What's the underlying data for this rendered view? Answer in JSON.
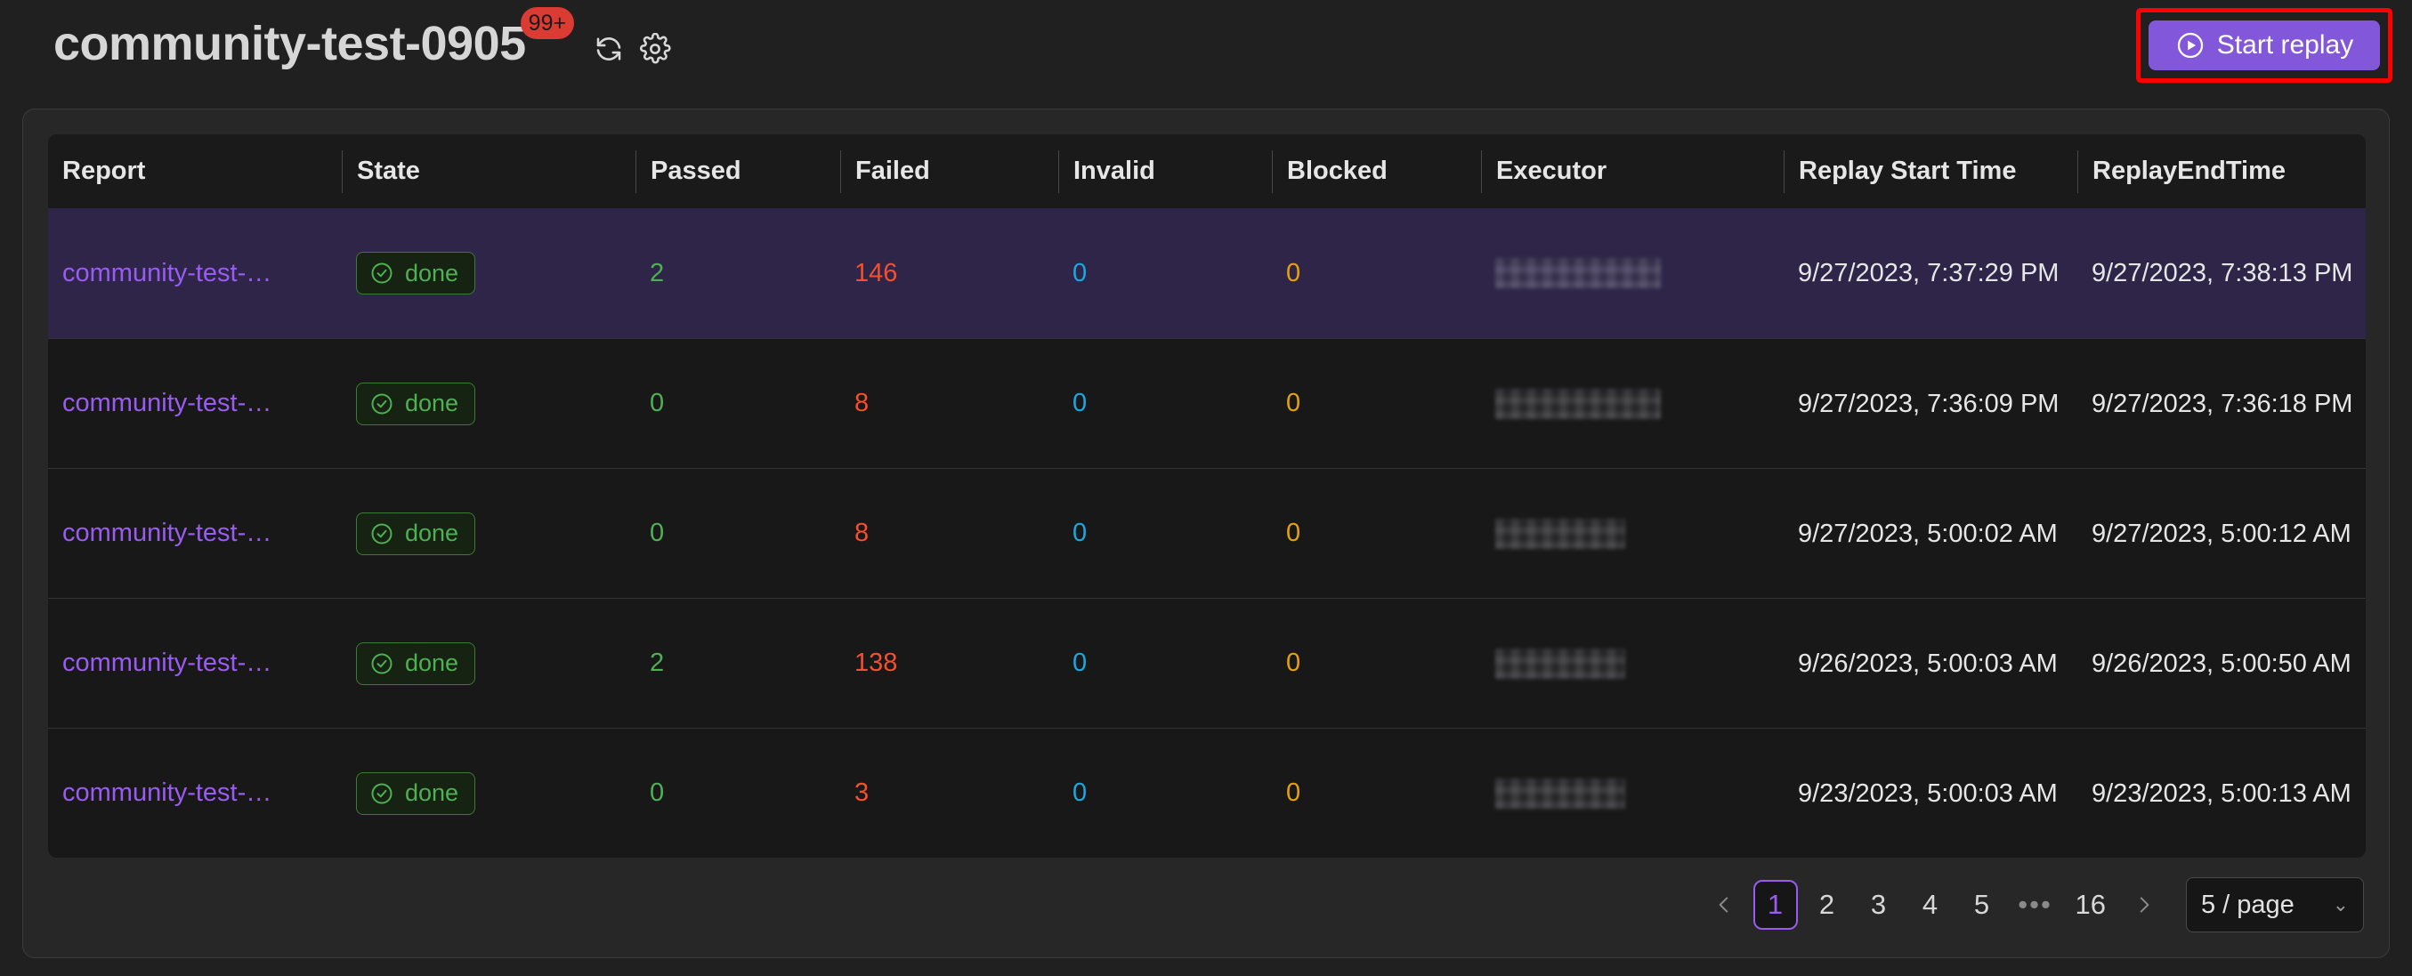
{
  "header": {
    "title": "community-test-0905",
    "badge_count": "99+",
    "badge_color": "#da3b32",
    "refresh_icon": "refresh-icon",
    "settings_icon": "gear-icon",
    "start_replay_label": "Start replay",
    "start_replay_icon": "play-circle-icon",
    "accent_color": "#8257d9",
    "highlight_color": "#fe0000"
  },
  "table": {
    "columns": [
      "Report",
      "State",
      "Passed",
      "Failed",
      "Invalid",
      "Blocked",
      "Executor",
      "Replay Start Time",
      "ReplayEndTime"
    ],
    "rows": [
      {
        "report": "community-test-…",
        "state": "done",
        "passed": "2",
        "failed": "146",
        "invalid": "0",
        "blocked": "0",
        "executor": "",
        "start": "9/27/2023, 7:37:29 PM",
        "end": "9/27/2023, 7:38:13 PM",
        "selected": true
      },
      {
        "report": "community-test-…",
        "state": "done",
        "passed": "0",
        "failed": "8",
        "invalid": "0",
        "blocked": "0",
        "executor": "",
        "start": "9/27/2023, 7:36:09 PM",
        "end": "9/27/2023, 7:36:18 PM",
        "selected": false
      },
      {
        "report": "community-test-…",
        "state": "done",
        "passed": "0",
        "failed": "8",
        "invalid": "0",
        "blocked": "0",
        "executor": "",
        "start": "9/27/2023, 5:00:02 AM",
        "end": "9/27/2023, 5:00:12 AM",
        "selected": false
      },
      {
        "report": "community-test-…",
        "state": "done",
        "passed": "2",
        "failed": "138",
        "invalid": "0",
        "blocked": "0",
        "executor": "",
        "start": "9/26/2023, 5:00:03 AM",
        "end": "9/26/2023, 5:00:50 AM",
        "selected": false
      },
      {
        "report": "community-test-…",
        "state": "done",
        "passed": "0",
        "failed": "3",
        "invalid": "0",
        "blocked": "0",
        "executor": "",
        "start": "9/23/2023, 5:00:03 AM",
        "end": "9/23/2023, 5:00:13 AM",
        "selected": false
      }
    ],
    "state_icon": "check-circle-icon",
    "colors": {
      "passed": "#4fb053",
      "failed": "#f2502e",
      "invalid": "#1ba7e0",
      "blocked": "#e5a00d",
      "link": "#9a5cf0",
      "selected_row": "#2e2548"
    }
  },
  "pagination": {
    "prev_label": "‹",
    "next_label": "›",
    "pages": [
      "1",
      "2",
      "3",
      "4",
      "5"
    ],
    "ellipsis": "•••",
    "last_page": "16",
    "active_page": "1",
    "page_size_label": "5 / page",
    "page_size_caret": "⌄"
  }
}
